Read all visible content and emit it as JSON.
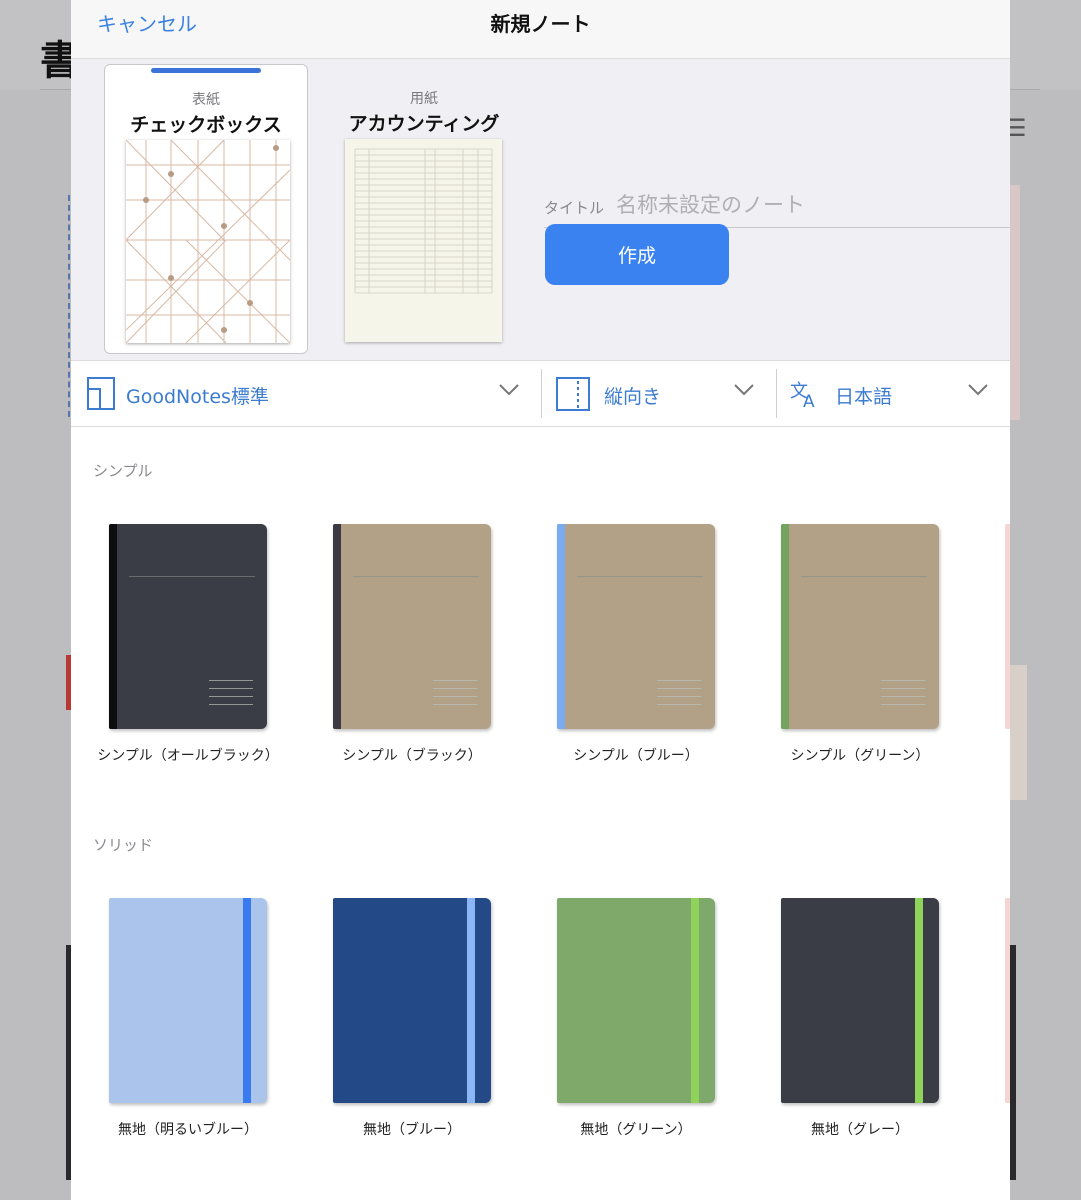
{
  "background": {
    "title_char": "書",
    "menu_icon": "list-icon"
  },
  "nav": {
    "cancel": "キャンセル",
    "title": "新規ノート"
  },
  "templates": [
    {
      "caption": "表紙",
      "name": "チェックボックス",
      "selected": true
    },
    {
      "caption": "用紙",
      "name": "アカウンティング",
      "selected": false
    }
  ],
  "title_field": {
    "label": "タイトル",
    "placeholder": "名称未設定のノート",
    "value": ""
  },
  "create_button": "作成",
  "toolbar": {
    "template_set": "GoodNotes標準",
    "orientation": "縦向き",
    "language": "日本語"
  },
  "sections": [
    {
      "title": "シンプル",
      "items": [
        {
          "label": "シンプル（オールブラック）",
          "cover": "#3a3d45",
          "spine": "#0d0d0f"
        },
        {
          "label": "シンプル（ブラック）",
          "cover": "#b2a186",
          "spine": "#3c3944"
        },
        {
          "label": "シンプル（ブルー）",
          "cover": "#b2a186",
          "spine": "#7aaaf0"
        },
        {
          "label": "シンプル（グリーン）",
          "cover": "#b2a186",
          "spine": "#73a35e"
        }
      ]
    },
    {
      "title": "ソリッド",
      "items": [
        {
          "label": "無地（明るいブルー）",
          "cover": "#aac4ec",
          "band": "#3a7af0"
        },
        {
          "label": "無地（ブルー）",
          "cover": "#234a86",
          "band": "#8bb6f5"
        },
        {
          "label": "無地（グリーン）",
          "cover": "#7ea96a",
          "band": "#8fd35a"
        },
        {
          "label": "無地（グレー）",
          "cover": "#3a3d45",
          "band": "#8fd35a"
        }
      ]
    }
  ],
  "colors": {
    "accent": "#3b82e0",
    "create": "#3a82f0"
  }
}
